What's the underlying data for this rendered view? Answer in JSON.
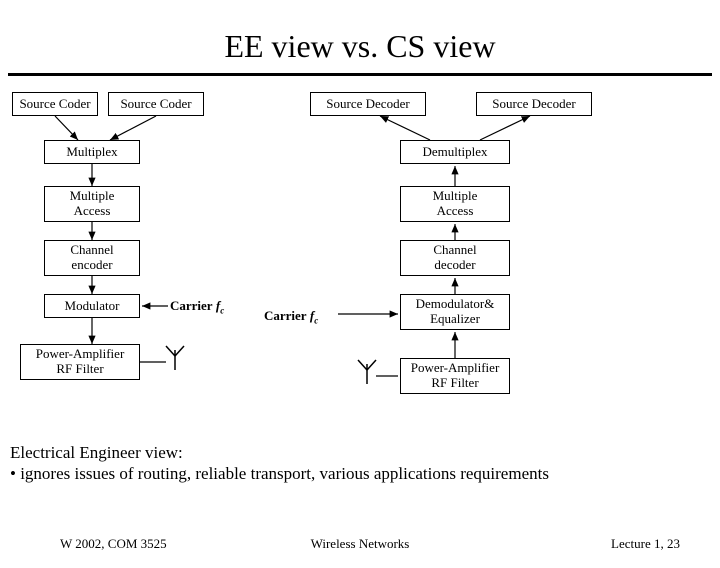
{
  "title": "EE view vs. CS view",
  "tx": {
    "source_coder_1": "Source Coder",
    "source_coder_2": "Source Coder",
    "multiplex": "Multiplex",
    "multiple_access": "Multiple\nAccess",
    "channel_encoder": "Channel\nencoder",
    "modulator": "Modulator",
    "pa_rf": "Power-Amplifier\nRF Filter"
  },
  "rx": {
    "source_decoder_1": "Source Decoder",
    "source_decoder_2": "Source Decoder",
    "demultiplex": "Demultiplex",
    "multiple_access": "Multiple\nAccess",
    "channel_decoder": "Channel\ndecoder",
    "demod_eq": "Demodulator&\nEqualizer",
    "pa_rf": "Power-Amplifier\nRF Filter"
  },
  "carrier_label_tx": "Carrier",
  "carrier_label_rx": "Carrier",
  "carrier_sub": "f",
  "carrier_sub2": "c",
  "bullets": {
    "line1": "Electrical Engineer view:",
    "line2": "• ignores issues of routing, reliable transport, various applications requirements"
  },
  "footer": {
    "left": "W 2002, COM 3525",
    "center": "Wireless Networks",
    "right": "Lecture 1, 23"
  }
}
